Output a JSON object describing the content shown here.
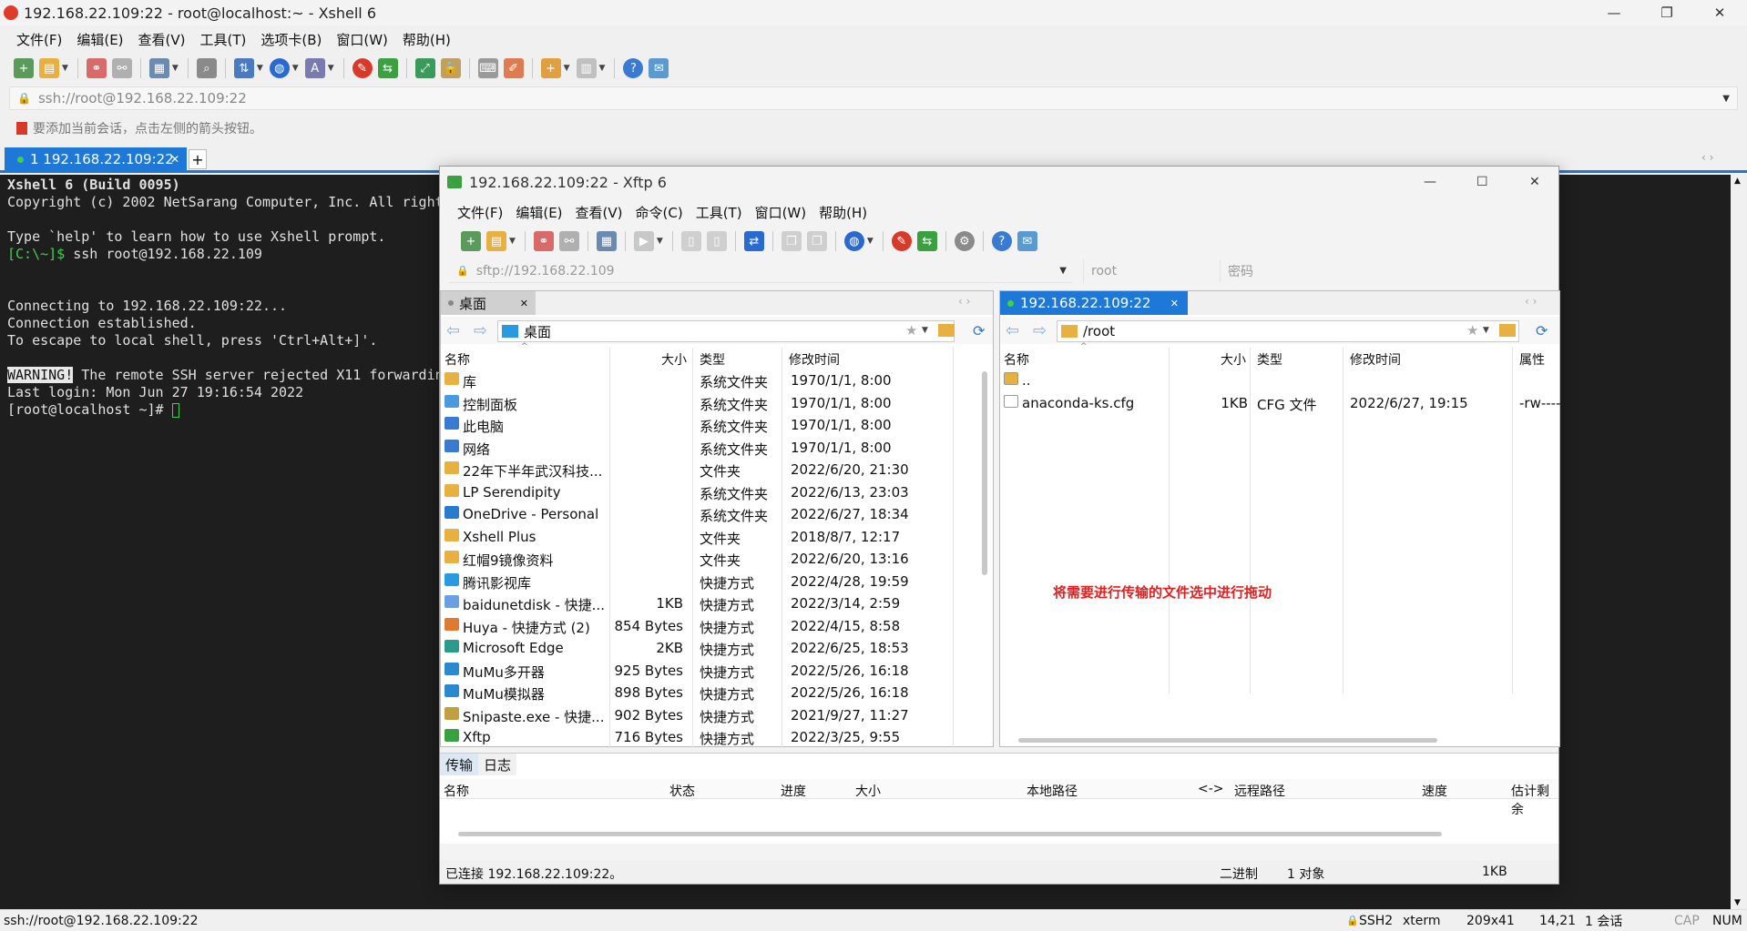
{
  "xshell": {
    "title": "192.168.22.109:22 - root@localhost:~ - Xshell 6",
    "menu": [
      "文件(F)",
      "编辑(E)",
      "查看(V)",
      "工具(T)",
      "选项卡(B)",
      "窗口(W)",
      "帮助(H)"
    ],
    "address": "ssh://root@192.168.22.109:22",
    "hint": "要添加当前会话，点击左侧的箭头按钮。",
    "tab_label": "1 192.168.22.109:22",
    "terminal": {
      "line1": "Xshell 6 (Build 0095)",
      "line2": "Copyright (c) 2002 NetSarang Computer, Inc. All right",
      "line3": "Type `help' to learn how to use Xshell prompt.",
      "line4_prompt": "[C:\\~]$",
      "line4_cmd": " ssh root@192.168.22.109",
      "line5": "Connecting to 192.168.22.109:22...",
      "line6": "Connection established.",
      "line7": "To escape to local shell, press 'Ctrl+Alt+]'.",
      "line8_warn": "WARNING!",
      "line8_rest": " The remote SSH server rejected X11 forwardin",
      "line9": "Last login: Mon Jun 27 19:16:54 2022",
      "line10": "[root@localhost ~]# "
    },
    "status": {
      "left": "ssh://root@192.168.22.109:22",
      "ssh": "SSH2",
      "term": "xterm",
      "size": "209x41",
      "pos": "14,21",
      "sessions": "1 会话",
      "cap": "CAP",
      "num": "NUM"
    }
  },
  "xftp": {
    "title": "192.168.22.109:22   - Xftp 6",
    "menu": [
      "文件(F)",
      "编辑(E)",
      "查看(V)",
      "命令(C)",
      "工具(T)",
      "窗口(W)",
      "帮助(H)"
    ],
    "address": "sftp://192.168.22.109",
    "user_placeholder": "root",
    "pass_placeholder": "密码",
    "local": {
      "tab": "桌面",
      "path": "桌面",
      "headers": [
        "名称",
        "大小",
        "类型",
        "修改时间"
      ],
      "rows": [
        {
          "name": "库",
          "size": "",
          "type": "系统文件夹",
          "date": "1970/1/1, 8:00"
        },
        {
          "name": "控制面板",
          "size": "",
          "type": "系统文件夹",
          "date": "1970/1/1, 8:00"
        },
        {
          "name": "此电脑",
          "size": "",
          "type": "系统文件夹",
          "date": "1970/1/1, 8:00"
        },
        {
          "name": "网络",
          "size": "",
          "type": "系统文件夹",
          "date": "1970/1/1, 8:00"
        },
        {
          "name": "22年下半年武汉科技...",
          "size": "",
          "type": "文件夹",
          "date": "2022/6/20, 21:30"
        },
        {
          "name": "LP Serendipity",
          "size": "",
          "type": "系统文件夹",
          "date": "2022/6/13, 23:03"
        },
        {
          "name": "OneDrive - Personal",
          "size": "",
          "type": "系统文件夹",
          "date": "2022/6/27, 18:34"
        },
        {
          "name": "Xshell Plus",
          "size": "",
          "type": "文件夹",
          "date": "2018/8/7, 12:17"
        },
        {
          "name": "红帽9镜像资料",
          "size": "",
          "type": "文件夹",
          "date": "2022/6/20, 13:16"
        },
        {
          "name": "腾讯影视库",
          "size": "",
          "type": "快捷方式",
          "date": "2022/4/28, 19:59"
        },
        {
          "name": "baidunetdisk - 快捷...",
          "size": "1KB",
          "type": "快捷方式",
          "date": "2022/3/14, 2:59"
        },
        {
          "name": "Huya - 快捷方式 (2)",
          "size": "854 Bytes",
          "type": "快捷方式",
          "date": "2022/4/15, 8:58"
        },
        {
          "name": "Microsoft Edge",
          "size": "2KB",
          "type": "快捷方式",
          "date": "2022/6/25, 18:53"
        },
        {
          "name": "MuMu多开器",
          "size": "925 Bytes",
          "type": "快捷方式",
          "date": "2022/5/26, 16:18"
        },
        {
          "name": "MuMu模拟器",
          "size": "898 Bytes",
          "type": "快捷方式",
          "date": "2022/5/26, 16:18"
        },
        {
          "name": "Snipaste.exe - 快捷...",
          "size": "902 Bytes",
          "type": "快捷方式",
          "date": "2021/9/27, 11:27"
        },
        {
          "name": "Xftp",
          "size": "716 Bytes",
          "type": "快捷方式",
          "date": "2022/3/25, 9:55"
        }
      ]
    },
    "remote": {
      "tab": "192.168.22.109:22",
      "path": "/root",
      "headers": [
        "名称",
        "大小",
        "类型",
        "修改时间",
        "属性"
      ],
      "rows": [
        {
          "name": "..",
          "size": "",
          "type": "",
          "date": "",
          "attr": ""
        },
        {
          "name": "anaconda-ks.cfg",
          "size": "1KB",
          "type": "CFG 文件",
          "date": "2022/6/27, 19:15",
          "attr": "-rw----"
        }
      ],
      "annotation": "将需要进行传输的文件选中进行拖动"
    },
    "transfer": {
      "tab1": "传输",
      "tab2": "日志",
      "headers": [
        "名称",
        "状态",
        "进度",
        "大小",
        "本地路径",
        "<->",
        "远程路径",
        "速度",
        "估计剩余"
      ]
    },
    "status": {
      "connected": "已连接 192.168.22.109:22。",
      "mode": "二进制",
      "objects": "1 对象",
      "size": "1KB"
    }
  }
}
